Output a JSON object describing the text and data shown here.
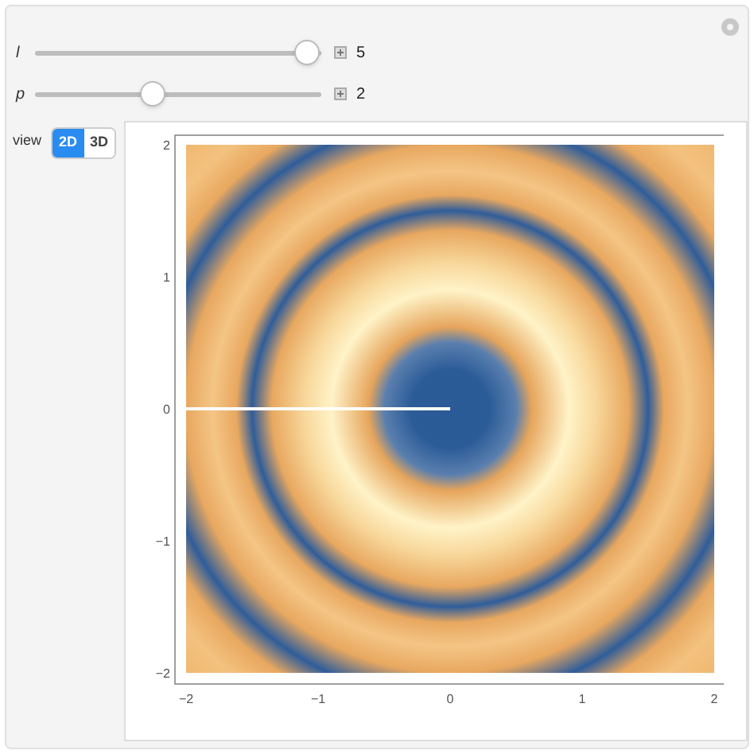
{
  "controls": [
    {
      "label": "l",
      "level": 0.95,
      "value": "5"
    },
    {
      "label": "p",
      "level": 0.41,
      "value": "2"
    }
  ],
  "view": {
    "label": "view",
    "options": [
      {
        "label": "2D",
        "selected": true
      },
      {
        "label": "3D",
        "selected": false
      }
    ]
  },
  "plot": {
    "x_ticks": [
      "−2",
      "−1",
      "0",
      "1",
      "2"
    ],
    "y_ticks": [
      "2",
      "1",
      "0",
      "−1",
      "−2"
    ]
  }
}
